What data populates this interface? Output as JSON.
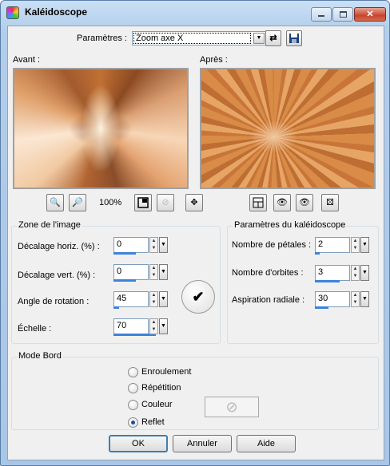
{
  "window": {
    "title": "Kaléidoscope"
  },
  "params": {
    "label": "Paramètres :",
    "value": "Zoom axe X"
  },
  "preview": {
    "before_label": "Avant :",
    "after_label": "Après :",
    "zoom": "100%"
  },
  "zone_image": {
    "title": "Zone de l'image",
    "fields": [
      {
        "label": "Décalage horiz. (%) :",
        "value": "0",
        "fill": 0.5
      },
      {
        "label": "Décalage vert. (%) :",
        "value": "0",
        "fill": 0.5
      },
      {
        "label": "Angle de rotation :",
        "value": "45",
        "fill": 0.12
      },
      {
        "label": "Échelle :",
        "value": "70",
        "fill": 0.95
      }
    ],
    "dial_glyph": "✔"
  },
  "kaleido": {
    "title": "Paramètres du kaléidoscope",
    "fields": [
      {
        "label": "Nombre de pétales :",
        "value": "2",
        "fill": 0.1
      },
      {
        "label": "Nombre d'orbites :",
        "value": "3",
        "fill": 0.55
      },
      {
        "label": "Aspiration radiale :",
        "value": "30",
        "fill": 0.3
      }
    ]
  },
  "mode_bord": {
    "title": "Mode Bord",
    "options": [
      "Enroulement",
      "Répétition",
      "Couleur",
      "Reflet"
    ],
    "selected": "Reflet"
  },
  "buttons": {
    "ok": "OK",
    "cancel": "Annuler",
    "help": "Aide"
  },
  "colors": {
    "accent": "#3d82dc",
    "title_bar": "#b2cde9"
  }
}
